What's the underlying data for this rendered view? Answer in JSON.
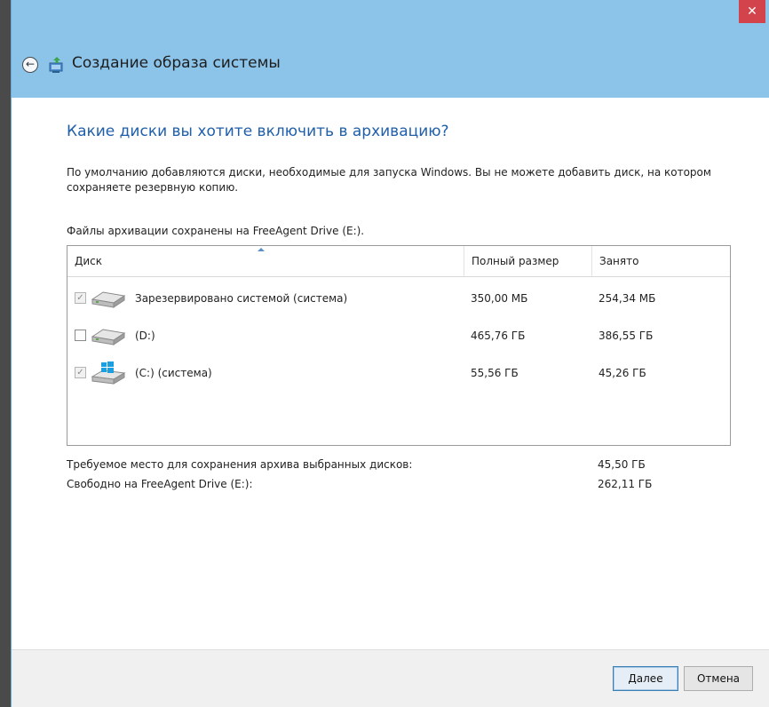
{
  "window": {
    "close_glyph": "✕",
    "colors": {
      "titlebar": "#8cc3e9",
      "close": "#d2434c",
      "heading": "#1f5faa"
    }
  },
  "header": {
    "back_icon": "back-arrow-icon",
    "title": "Создание образа системы"
  },
  "main": {
    "heading": "Какие диски вы хотите включить в архивацию?",
    "description": "По умолчанию добавляются диски, необходимые для запуска Windows. Вы не можете добавить диск, на котором сохраняете резервную копию.",
    "location": "Файлы архивации сохранены на FreeAgent Drive (E:).",
    "table": {
      "columns": [
        "Диск",
        "Полный размер",
        "Занято"
      ],
      "rows": [
        {
          "checked": true,
          "locked": true,
          "icon": "drive-icon",
          "name": "Зарезервировано системой (система)",
          "size": "350,00 МБ",
          "used": "254,34 МБ"
        },
        {
          "checked": false,
          "locked": false,
          "icon": "drive-icon",
          "name": "(D:)",
          "size": "465,76 ГБ",
          "used": "386,55 ГБ"
        },
        {
          "checked": true,
          "locked": true,
          "icon": "windows-drive-icon",
          "name": "(C:) (система)",
          "size": "55,56 ГБ",
          "used": "45,26 ГБ"
        }
      ]
    },
    "summary": [
      {
        "label": "Требуемое место для сохранения архива выбранных дисков:",
        "value": "45,50 ГБ"
      },
      {
        "label": "Свободно на FreeAgent Drive (E:):",
        "value": "262,11 ГБ"
      }
    ]
  },
  "footer": {
    "next_label": "Далее",
    "cancel_label": "Отмена"
  }
}
